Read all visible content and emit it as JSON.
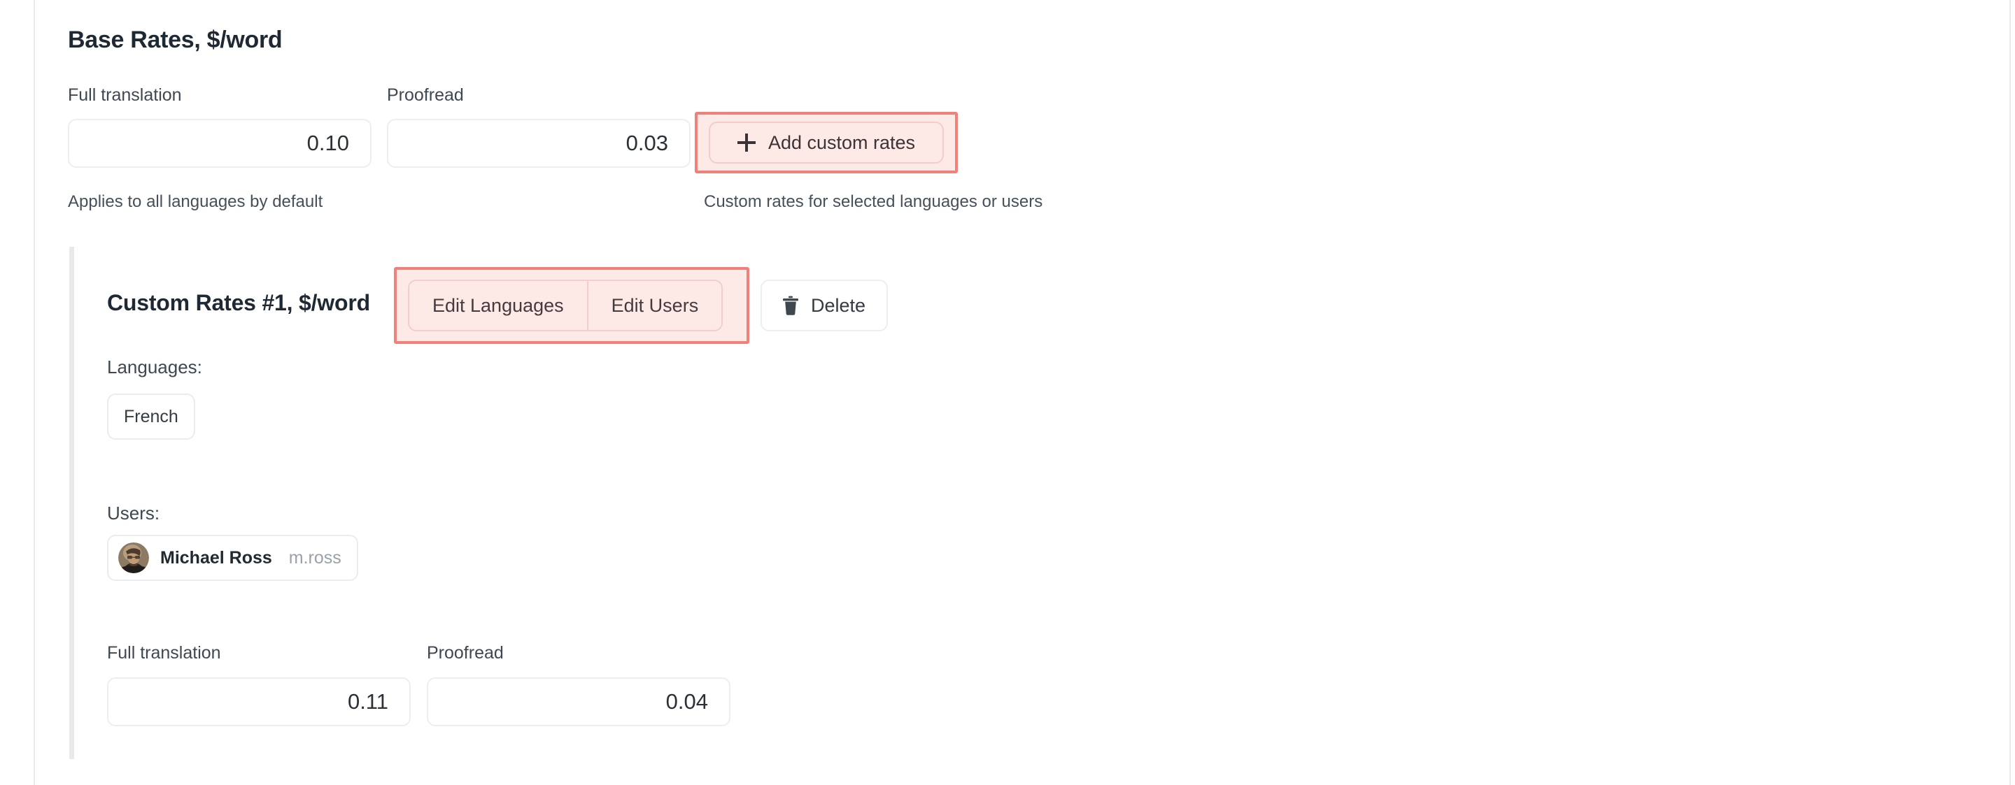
{
  "base_rates": {
    "title": "Base Rates, $/word",
    "full_translation_label": "Full translation",
    "full_translation_value": "0.10",
    "proofread_label": "Proofread",
    "proofread_value": "0.03",
    "helper_left": "Applies to all languages by default",
    "helper_right": "Custom rates for selected languages or users",
    "add_button_label": "Add custom rates"
  },
  "custom_rates": {
    "title": "Custom Rates #1, $/word",
    "edit_languages_label": "Edit Languages",
    "edit_users_label": "Edit Users",
    "delete_label": "Delete",
    "languages_label": "Languages:",
    "languages": [
      {
        "name": "French"
      }
    ],
    "users_label": "Users:",
    "users": [
      {
        "name": "Michael Ross",
        "handle": "m.ross"
      }
    ],
    "full_translation_label": "Full translation",
    "full_translation_value": "0.11",
    "proofread_label": "Proofread",
    "proofread_value": "0.04"
  },
  "colors": {
    "highlight_border": "#f0817a",
    "highlight_fill": "#fdeae7",
    "text_primary": "#1f2933",
    "text_secondary": "#3d4852",
    "text_muted": "#9aa1a8",
    "input_border": "#eceef0",
    "divider": "#e9e9eb"
  }
}
